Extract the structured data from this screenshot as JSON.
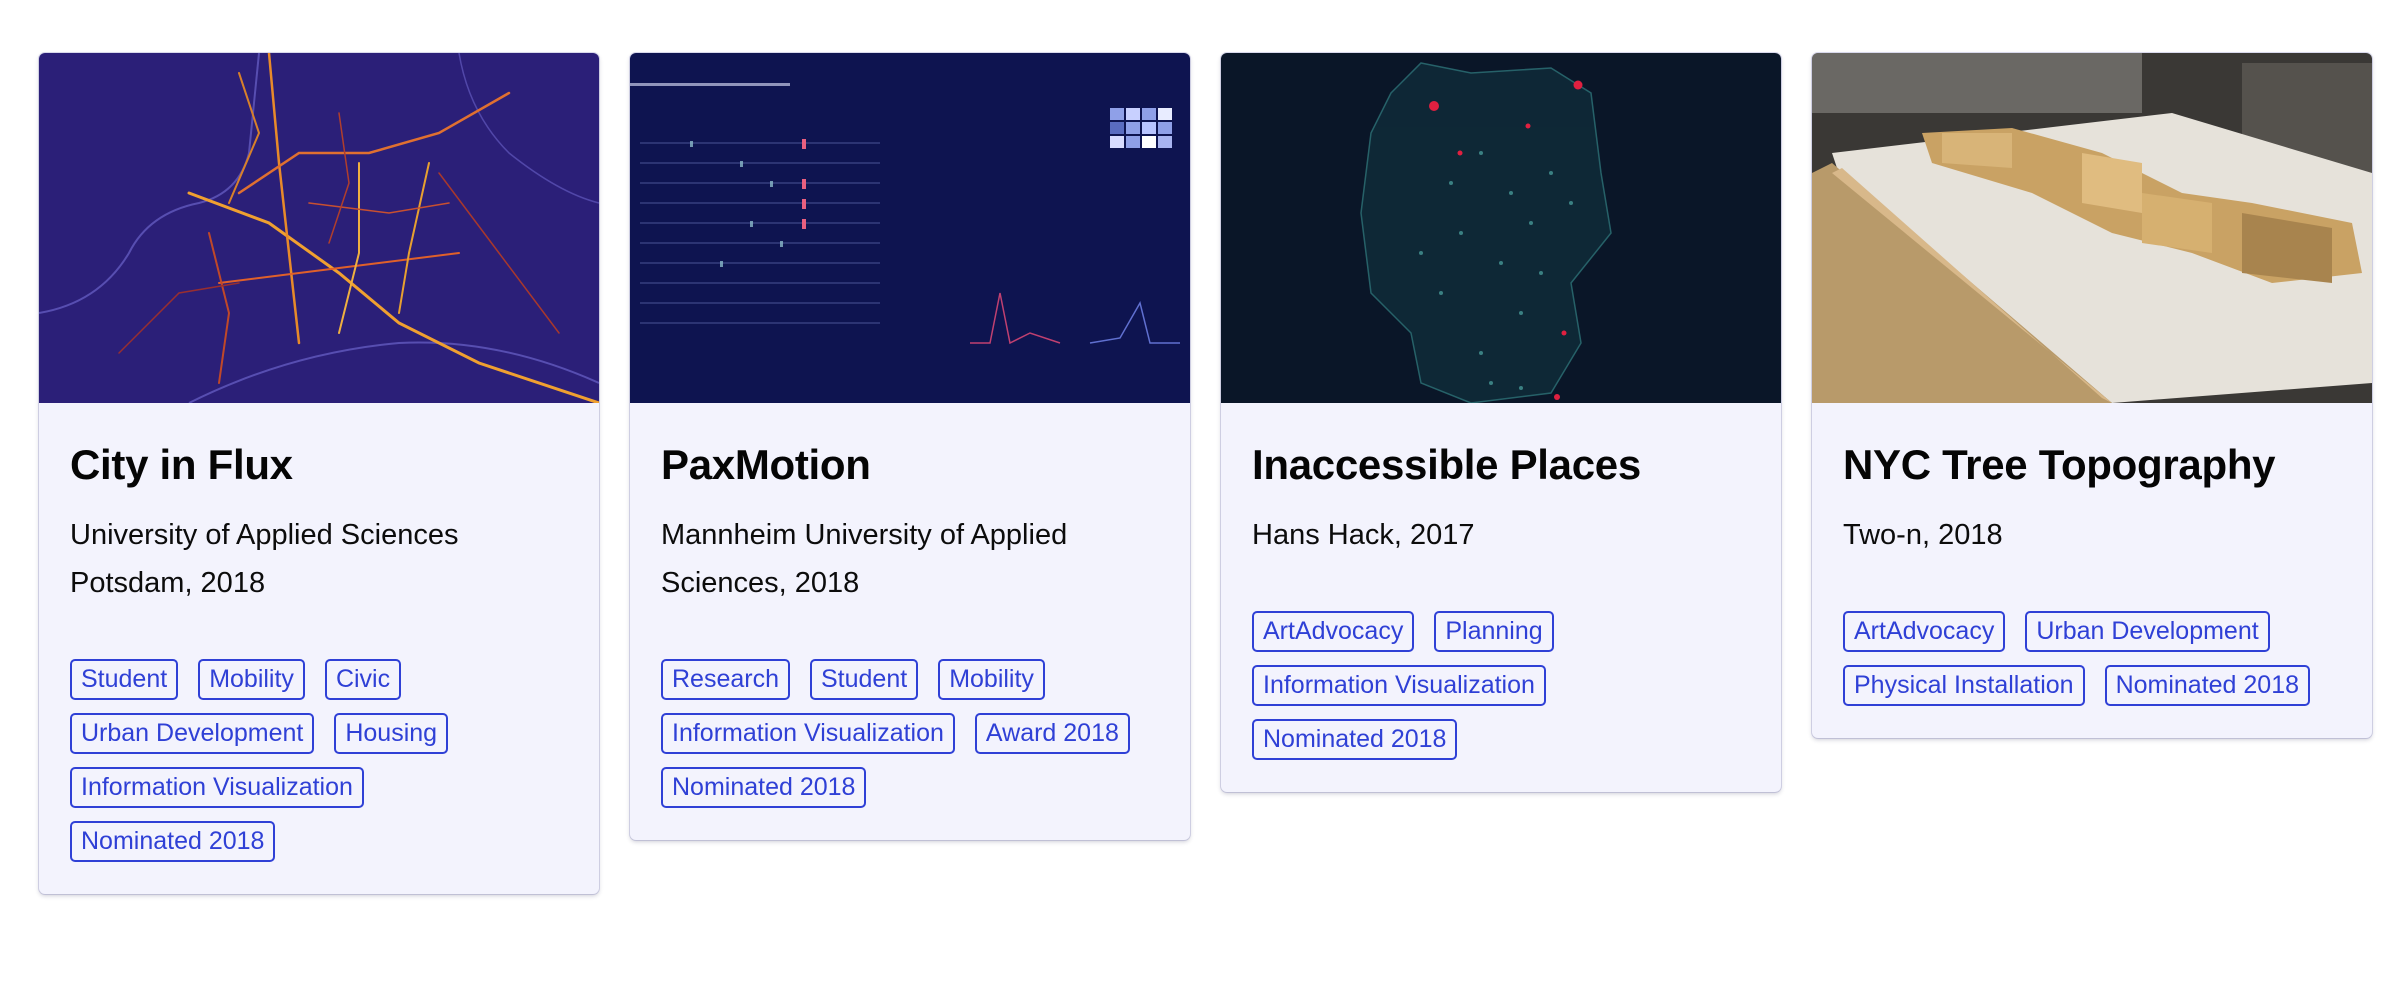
{
  "colors": {
    "card_background": "#f3f3fd",
    "tag_accent": "#2f40d6",
    "title_text": "#050505"
  },
  "projects": [
    {
      "title": "City in Flux",
      "subtitle": "University of Applied Sciences Potsdam, 2018",
      "image": "city-mobility-heatmap-thumbnail",
      "tags": [
        "Student",
        "Mobility",
        "Civic",
        "Urban Development",
        "Housing",
        "Information Visualization",
        "Nominated 2018"
      ]
    },
    {
      "title": "PaxMotion",
      "subtitle": "Mannheim University of Applied Sciences, 2018",
      "image": "passenger-dashboard-thumbnail",
      "tags": [
        "Research",
        "Student",
        "Mobility",
        "Information Visualization",
        "Award 2018",
        "Nominated 2018"
      ]
    },
    {
      "title": "Inaccessible Places",
      "subtitle": "Hans Hack, 2017",
      "image": "germany-dot-map-thumbnail",
      "tags": [
        "ArtAdvocacy",
        "Planning",
        "Information Visualization",
        "Nominated 2018"
      ]
    },
    {
      "title": "NYC Tree Topography",
      "subtitle": "Two-n, 2018",
      "image": "wooden-topography-model-thumbnail",
      "tags": [
        "ArtAdvocacy",
        "Urban Development",
        "Physical Installation",
        "Nominated 2018"
      ]
    }
  ]
}
